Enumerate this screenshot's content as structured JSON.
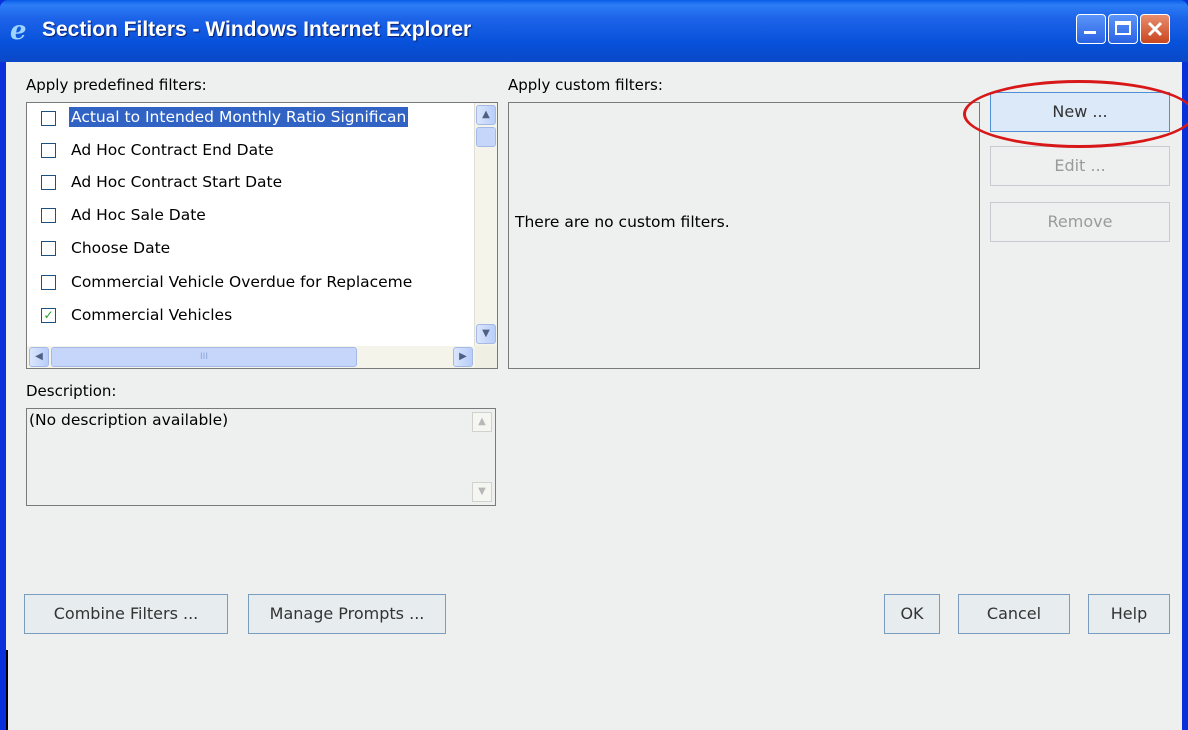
{
  "window": {
    "title": "Section Filters - Windows Internet Explorer",
    "controls": {
      "minimize": "_",
      "maximize": "□",
      "close": "✕"
    }
  },
  "predefined": {
    "label": "Apply predefined filters:",
    "items": [
      {
        "label": "Actual to Intended Monthly Ratio Significan",
        "checked": false,
        "selected": true
      },
      {
        "label": "Ad Hoc Contract End Date",
        "checked": false
      },
      {
        "label": "Ad Hoc Contract Start Date",
        "checked": false
      },
      {
        "label": "Ad Hoc Sale Date",
        "checked": false
      },
      {
        "label": "Choose Date",
        "checked": false
      },
      {
        "label": "Commercial Vehicle Overdue for Replaceme",
        "checked": false
      },
      {
        "label": "Commercial Vehicles",
        "checked": true
      }
    ],
    "scroll_glyphs": {
      "up": "▲",
      "down": "▼",
      "left": "◀",
      "right": "▶",
      "grip": "III"
    }
  },
  "custom": {
    "label": "Apply custom filters:",
    "empty_message": "There are no custom filters.",
    "buttons": {
      "new": "New ...",
      "edit": "Edit ...",
      "remove": "Remove"
    }
  },
  "description": {
    "label": "Description:",
    "text": "(No description available)"
  },
  "footer": {
    "combine": "Combine Filters ...",
    "manage": "Manage Prompts ...",
    "ok": "OK",
    "cancel": "Cancel",
    "help": "Help"
  },
  "colors": {
    "accent": "#3163c5",
    "highlight_circle": "#d81818",
    "titlebar": "#0751da"
  }
}
